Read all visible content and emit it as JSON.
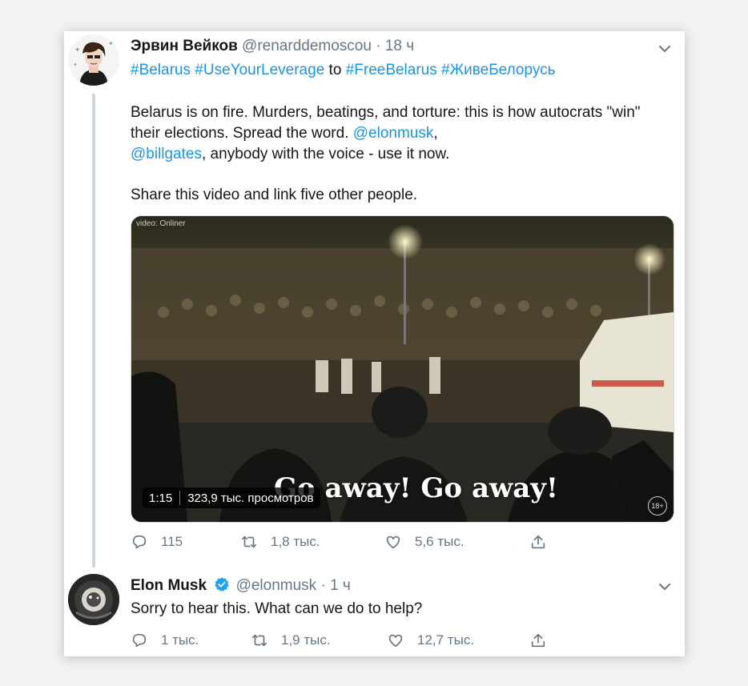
{
  "tweet": {
    "author_name": "Эрвин Вейков",
    "handle": "@renarddemoscou",
    "separator": "·",
    "time": "18 ч",
    "hashtags": {
      "tag1": "#Belarus",
      "tag2": "#UseYourLeverage",
      "word_to": "to",
      "tag3": "#FreeBelarus",
      "tag4": "#ЖивеБелорусь"
    },
    "para": {
      "part1": "Belarus is on fire. Murders, beatings, and torture: this is how autocrats \"win\" their elections. Spread the word. ",
      "mention1": "@elonmusk",
      "comma": ",",
      "mention2": "@billgates",
      "part2": ", anybody with the voice - use it now."
    },
    "share_line": "Share this video and link five other people.",
    "media": {
      "watermark": "video: Onliner",
      "subtitle": "Go away! Go away!",
      "duration": "1:15",
      "views": "323,9 тыс. просмотров",
      "age_rating": "18+"
    },
    "actions": {
      "replies": "115",
      "retweets": "1,8 тыс.",
      "likes": "5,6 тыс."
    }
  },
  "reply": {
    "author_name": "Elon Musk",
    "handle": "@elonmusk",
    "separator": "·",
    "time": "1 ч",
    "text": "Sorry to hear this. What can we do to help?",
    "actions": {
      "replies": "1 тыс.",
      "retweets": "1,9 тыс.",
      "likes": "12,7 тыс."
    }
  },
  "colors": {
    "link": "#1b95e0",
    "muted": "#657786",
    "verified": "#1da1f2"
  }
}
